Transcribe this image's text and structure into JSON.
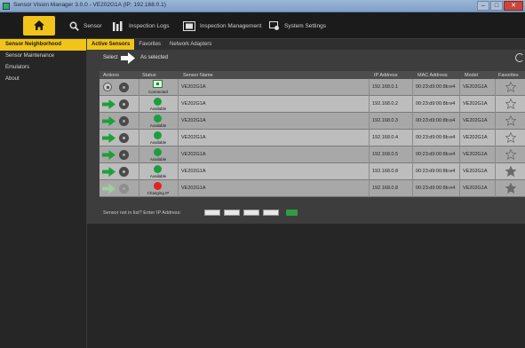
{
  "window": {
    "title": "Sensor Vision Manager 3.0.0 - VE202G1A (IP: 192.168.0.1)",
    "buttons": [
      "–",
      "□",
      "✕"
    ]
  },
  "toolbar": {
    "home_icon": "home-icon",
    "items": [
      {
        "label": "Sensor",
        "icon": "search-icon"
      },
      {
        "label": "Inspection Logs",
        "icon": "chart-icon"
      },
      {
        "label": "Inspection Management",
        "icon": "film-icon"
      },
      {
        "label": "System Settings",
        "icon": "settings-icon"
      }
    ]
  },
  "sidebar": {
    "items": [
      {
        "label": "Sensor Neighborhood",
        "active": true
      },
      {
        "label": "Sensor Maintenance",
        "active": false
      },
      {
        "label": "Emulators",
        "active": false
      },
      {
        "label": "About",
        "active": false
      }
    ]
  },
  "tabs": [
    {
      "label": "Active Sensors",
      "active": true
    },
    {
      "label": "Favorites",
      "active": false
    },
    {
      "label": "Network Adapters",
      "active": false
    }
  ],
  "select_bar": {
    "label": "Select",
    "status": "As selected"
  },
  "table": {
    "columns": [
      "Actions",
      "Status",
      "Sensor Name",
      "IP Address",
      "MAC Address",
      "Model",
      "Favorites"
    ],
    "rows": [
      {
        "action": "stop",
        "status": "Connected",
        "status_color": "box",
        "name": "VE202G1A",
        "ip": "192.168.0.1",
        "mac": "00:23:d9:00:8b:e4",
        "model": "VE202G1A",
        "favorite": false
      },
      {
        "action": "connect",
        "status": "Available",
        "status_color": "green",
        "name": "VE202G1A",
        "ip": "192.168.0.2",
        "mac": "00:23:d9:00:8b:e4",
        "model": "VE202G1A",
        "favorite": false
      },
      {
        "action": "connect",
        "status": "Available",
        "status_color": "green",
        "name": "VE202G1A",
        "ip": "192.168.0.3",
        "mac": "00:23:d9:00:8b:e4",
        "model": "VE202G1A",
        "favorite": false
      },
      {
        "action": "connect",
        "status": "Available",
        "status_color": "green",
        "name": "VE202G1A",
        "ip": "192.168.0.4",
        "mac": "00:23:d9:00:8b:e4",
        "model": "VE202G1A",
        "favorite": false
      },
      {
        "action": "connect",
        "status": "Available",
        "status_color": "green",
        "name": "VE202G1A",
        "ip": "192.168.0.5",
        "mac": "00:23:d9:00:8b:e4",
        "model": "VE202G1A",
        "favorite": false
      },
      {
        "action": "connect",
        "status": "Available",
        "status_color": "green",
        "name": "VE202G1A",
        "ip": "192.168.0.8",
        "mac": "00:23:d9:00:8b:e4",
        "model": "VE202G1A",
        "favorite": true
      },
      {
        "action": "connect-disabled",
        "status": "Changing IP",
        "status_color": "red",
        "name": "VE202G1A",
        "ip": "192.168.0.8",
        "mac": "00:23:d9:00:8b:e4",
        "model": "VE202G1A",
        "favorite": true
      }
    ]
  },
  "footer": {
    "text": "Sensor not in list?  Enter IP Address:",
    "ip_fields": [
      "",
      "",
      "",
      ""
    ]
  },
  "colors": {
    "accent": "#f0c419",
    "available": "#1aa03a",
    "changing": "#e02424"
  }
}
